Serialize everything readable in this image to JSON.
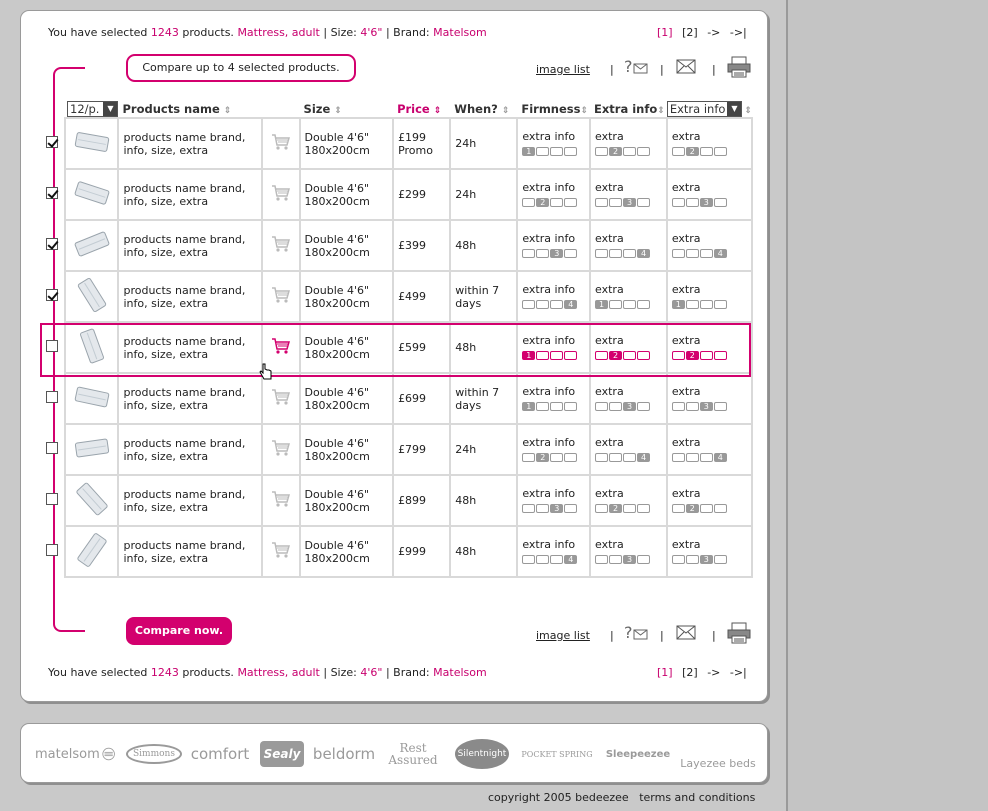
{
  "summary": {
    "prefix": "You have selected",
    "count": "1243",
    "mid": "products.",
    "category": "Mattress, adult",
    "size_label": "| Size:",
    "size_value": "4'6\"",
    "brand_label": "| Brand:",
    "brand_value": "Matelsom"
  },
  "pager": {
    "page1": "[1]",
    "page2": "[2]",
    "next": "->",
    "last": "->|"
  },
  "compare": {
    "tip": "Compare up to 4 selected products.",
    "button": "Compare now."
  },
  "tools": {
    "image_list": "image list",
    "sep": "|"
  },
  "table": {
    "per_page": "12/p.",
    "headers": {
      "name": "Products name",
      "size": "Size",
      "price": "Price",
      "when": "When?",
      "firmness": "Firmness",
      "extra": "Extra info",
      "extra_select": "Extra info"
    },
    "rows": [
      {
        "checked": true,
        "name": "products name brand, info, size, extra",
        "size": "Double 4'6\" 180x200cm",
        "price": "£199 Promo",
        "when": "24h",
        "c1": "extra info",
        "c1v": 1,
        "c2": "extra",
        "c2v": 2,
        "c3": "extra",
        "c3v": 2
      },
      {
        "checked": true,
        "name": "products name brand, info, size, extra",
        "size": "Double 4'6\" 180x200cm",
        "price": "£299",
        "when": "24h",
        "c1": "extra info",
        "c1v": 2,
        "c2": "extra",
        "c2v": 3,
        "c3": "extra",
        "c3v": 3
      },
      {
        "checked": true,
        "name": "products name brand, info, size, extra",
        "size": "Double 4'6\" 180x200cm",
        "price": "£399",
        "when": "48h",
        "c1": "extra info",
        "c1v": 3,
        "c2": "extra",
        "c2v": 4,
        "c3": "extra",
        "c3v": 4
      },
      {
        "checked": true,
        "name": "products name brand, info, size, extra",
        "size": "Double 4'6\" 180x200cm",
        "price": "£499",
        "when": "within 7 days",
        "c1": "extra info",
        "c1v": 4,
        "c2": "extra",
        "c2v": 1,
        "c3": "extra",
        "c3v": 1
      },
      {
        "checked": false,
        "name": "products name brand, info, size, extra",
        "size": "Double 4'6\" 180x200cm",
        "price": "£599",
        "when": "48h",
        "c1": "extra info",
        "c1v": 1,
        "c2": "extra",
        "c2v": 2,
        "c3": "extra",
        "c3v": 2
      },
      {
        "checked": false,
        "name": "products name brand, info, size, extra",
        "size": "Double 4'6\" 180x200cm",
        "price": "£699",
        "when": "within 7 days",
        "c1": "extra info",
        "c1v": 1,
        "c2": "extra",
        "c2v": 3,
        "c3": "extra",
        "c3v": 3
      },
      {
        "checked": false,
        "name": "products name brand, info, size, extra",
        "size": "Double 4'6\" 180x200cm",
        "price": "£799",
        "when": "24h",
        "c1": "extra info",
        "c1v": 2,
        "c2": "extra",
        "c2v": 4,
        "c3": "extra",
        "c3v": 4
      },
      {
        "checked": false,
        "name": "products name brand, info, size, extra",
        "size": "Double 4'6\" 180x200cm",
        "price": "£899",
        "when": "48h",
        "c1": "extra info",
        "c1v": 3,
        "c2": "extra",
        "c2v": 2,
        "c3": "extra",
        "c3v": 2
      },
      {
        "checked": false,
        "name": "products name brand, info, size, extra",
        "size": "Double 4'6\" 180x200cm",
        "price": "£999",
        "when": "48h",
        "c1": "extra info",
        "c1v": 4,
        "c2": "extra",
        "c2v": 3,
        "c3": "extra",
        "c3v": 3
      }
    ],
    "highlight_row": 4
  },
  "colors": {
    "accent": "#d3006e",
    "text_accent": "#c8006e"
  },
  "brands": [
    "matelsom",
    "Simmons",
    "comfort",
    "Sealy",
    "beldorm",
    "Rest Assured",
    "Silentnight",
    "POCKET SPRING",
    "Sleepeezee",
    "Layezee beds"
  ],
  "footer": {
    "copyright": "copyright 2005 bedeezee",
    "terms": "terms and conditions"
  }
}
